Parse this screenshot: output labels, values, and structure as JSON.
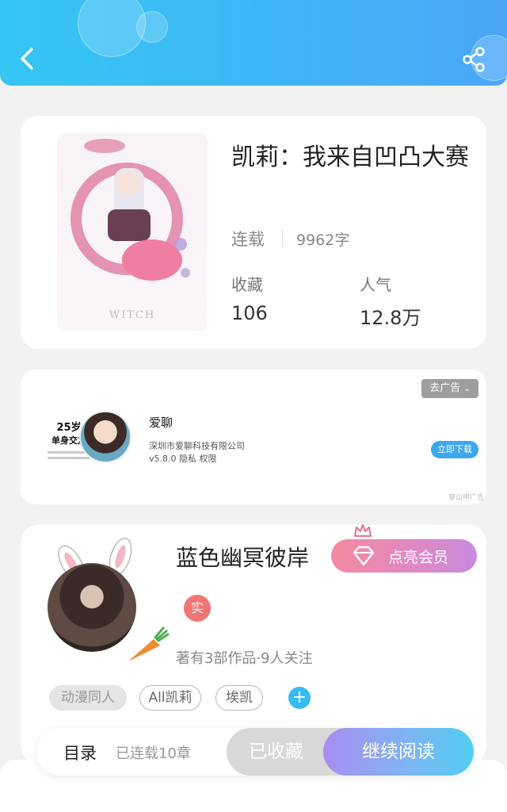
{
  "header": {
    "accent_color": "#3fb5f6",
    "back_icon": "chevron-left-icon",
    "share_icon": "share-icon"
  },
  "book": {
    "title": "凯莉：我来自凹凸大赛",
    "status": "连载",
    "word_count": "9962字",
    "favorites_label": "收藏",
    "favorites_value": "106",
    "popularity_label": "人气",
    "popularity_value": "12.8万",
    "cover_watermark": "WITCH"
  },
  "ad": {
    "remove_label": "去广告",
    "slogan_age": "25岁",
    "slogan_main": "单身交友",
    "app_name": "爱聊",
    "company": "深圳市爱聊科技有限公司",
    "version": "v5.8.0",
    "privacy": "隐私",
    "permissions": "权限",
    "download_label": "立即下载",
    "source": "穿山甲广告"
  },
  "author": {
    "name": "蓝色幽冥彼岸",
    "vip_label": "点亮会员",
    "badge": "实",
    "meta": "著有3部作品·9人关注",
    "tags": [
      "动漫同人",
      "All凯莉",
      "埃凯"
    ],
    "add_icon": "plus-icon"
  },
  "bottom_bar": {
    "toc_label": "目录",
    "chapter_count": "已连载10章",
    "favorited_label": "已收藏",
    "continue_label": "继续阅读"
  }
}
